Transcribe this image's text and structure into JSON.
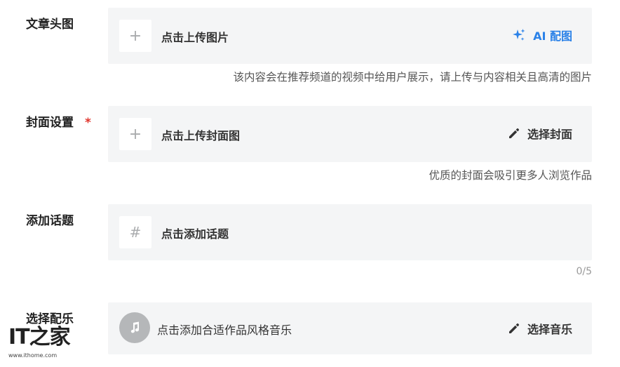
{
  "cover": {
    "label": "文章头图",
    "upload_label": "点击上传图片",
    "ai_label": "AI 配图",
    "hint": "该内容会在推荐频道的视频中给用户展示，请上传与内容相关且高清的图片"
  },
  "poster": {
    "label": "封面设置",
    "required_mark": "*",
    "upload_label": "点击上传封面图",
    "select_label": "选择封面",
    "hint": "优质的封面会吸引更多人浏览作品"
  },
  "topic": {
    "label": "添加话题",
    "add_label": "点击添加话题",
    "counter": "0/5"
  },
  "music": {
    "label": "选择配乐",
    "add_label": "点击添加合适作品风格音乐",
    "select_label": "选择音乐"
  },
  "watermark": {
    "logo_text": "IT之家",
    "url": "www.ithome.com"
  },
  "colors": {
    "accent": "#2b82e8",
    "required": "#e0342b",
    "box_bg": "#f4f5f6"
  }
}
